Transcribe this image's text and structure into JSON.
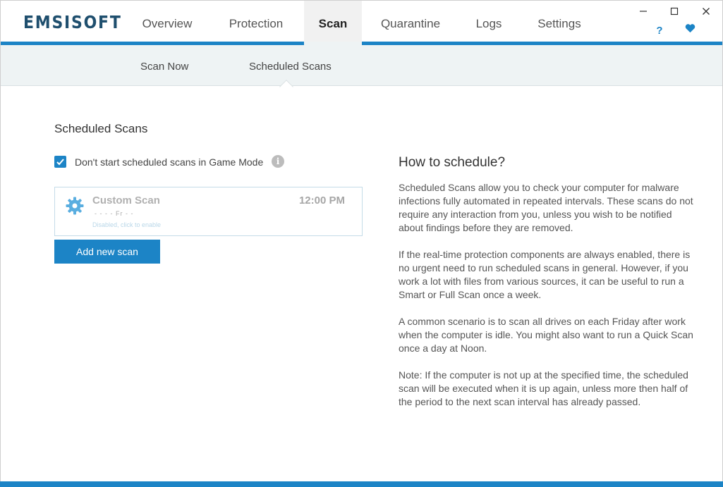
{
  "app": {
    "logo": "EMSISOFT"
  },
  "nav": {
    "tabs": [
      {
        "label": "Overview"
      },
      {
        "label": "Protection"
      },
      {
        "label": "Scan"
      },
      {
        "label": "Quarantine"
      },
      {
        "label": "Logs"
      },
      {
        "label": "Settings"
      }
    ],
    "active": "Scan"
  },
  "window_controls": {
    "minimize": "—",
    "maximize": "☐",
    "close": "✕"
  },
  "header_icons": {
    "help": "?",
    "heart": "♥"
  },
  "subnav": {
    "items": [
      {
        "label": "Scan Now"
      },
      {
        "label": "Scheduled Scans"
      }
    ],
    "active": "Scheduled Scans"
  },
  "main": {
    "section_title": "Scheduled Scans",
    "game_mode": {
      "label": "Don't start scheduled scans in Game Mode",
      "checked": true
    },
    "scans": [
      {
        "name": "Custom Scan",
        "time": "12:00 PM",
        "days": "- - - - Fr - -",
        "status": "Disabled, click to enable"
      }
    ],
    "add_button": "Add new scan"
  },
  "help": {
    "title": "How to schedule?",
    "paragraphs": [
      "Scheduled Scans allow you to check your computer for malware infections fully automated in repeated intervals. These scans do not require any interaction from you, unless you wish to be notified about findings before they are removed.",
      "If the real-time protection components are always enabled, there is no urgent need to run scheduled scans in general. However, if you work a lot with files from various sources, it can be useful to run a Smart or Full Scan once a week.",
      "A common scenario is to scan all drives on each Friday after work when the computer is idle. You might also want to run a Quick Scan once a day at Noon.",
      "Note: If the computer is not up at the specified time, the scheduled scan will be executed when it is up again, unless more then half of the period to the next scan interval has already passed."
    ]
  },
  "colors": {
    "accent": "#1c84c6",
    "logo": "#1f4f6e",
    "subnav_bg": "#eef3f4"
  },
  "icons": {
    "settings": "gear-icon",
    "info": "info-icon",
    "check": "check-icon"
  }
}
